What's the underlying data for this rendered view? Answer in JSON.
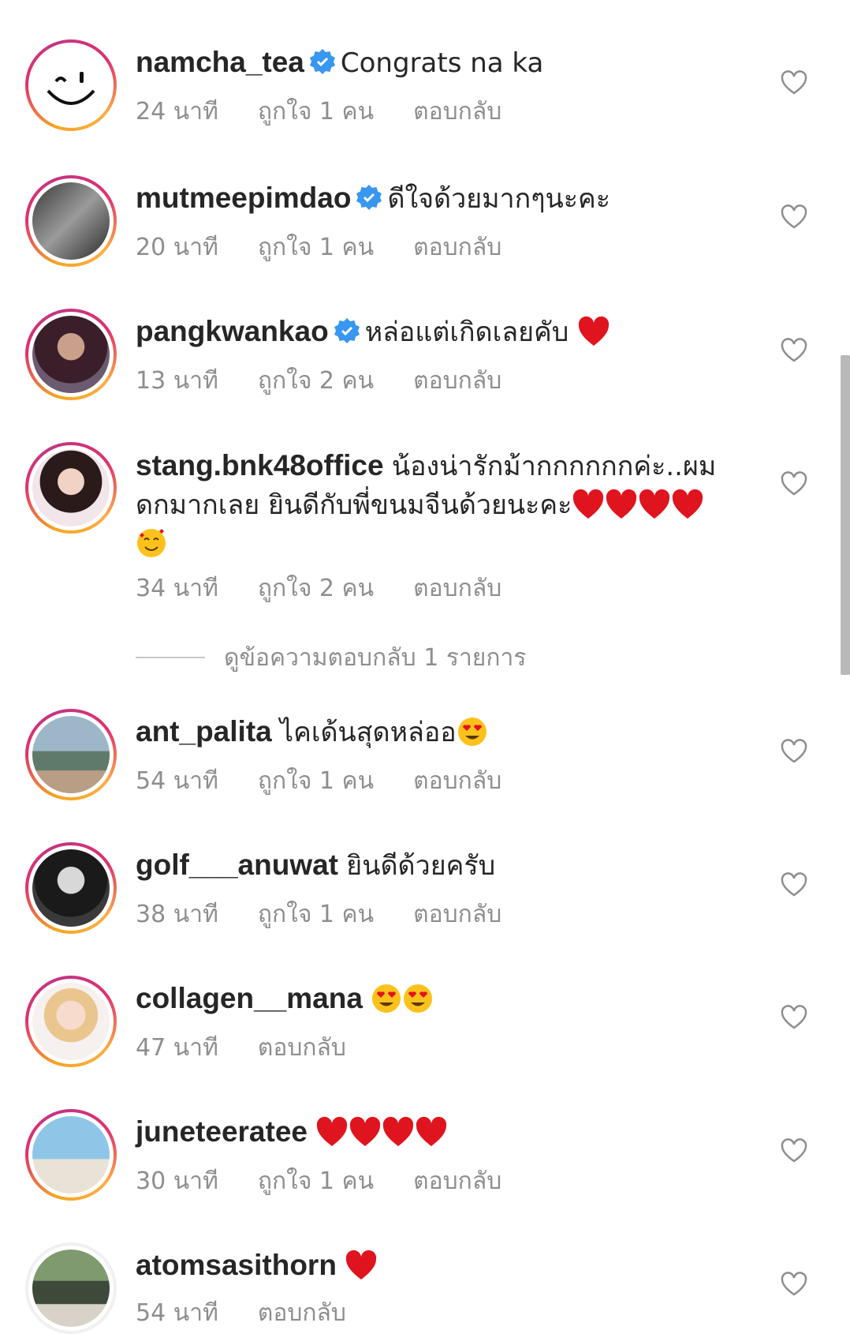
{
  "comments": [
    {
      "username": "namcha_tea",
      "verified": true,
      "text": "Congrats na ka",
      "emojis": [],
      "time": "24 นาที",
      "likes": "ถูกใจ 1 คน",
      "reply": "ตอบกลับ",
      "avatar_icon": "smiley-face-icon"
    },
    {
      "username": "mutmeepimdao",
      "verified": true,
      "text": "ดีใจด้วยมากๆนะคะ",
      "emojis": [],
      "time": "20 นาที",
      "likes": "ถูกใจ 1 คน",
      "reply": "ตอบกลับ",
      "avatar_icon": "profile-photo"
    },
    {
      "username": "pangkwankao",
      "verified": true,
      "text": "หล่อแต่เกิดเลยคับ",
      "emojis": [
        "red-heart"
      ],
      "time": "13 นาที",
      "likes": "ถูกใจ 2 คน",
      "reply": "ตอบกลับ",
      "avatar_icon": "profile-photo"
    },
    {
      "username": "stang.bnk48office",
      "verified": false,
      "text": "น้องน่ารักม้ากกกกกกค่ะ..ผมดกมากเลย ยินดีกับพี่ขนมจีนด้วยนะคะ",
      "emojis": [
        "red-heart",
        "red-heart",
        "red-heart",
        "red-heart",
        "smiling-face-with-hearts"
      ],
      "time": "34 นาที",
      "likes": "ถูกใจ 2 คน",
      "reply": "ตอบกลับ",
      "avatar_icon": "profile-photo"
    },
    {
      "username": "ant_palita",
      "verified": false,
      "text": "ไคเด้นสุดหล่ออ",
      "emojis": [
        "heart-eyes"
      ],
      "time": "54 นาที",
      "likes": "ถูกใจ 1 คน",
      "reply": "ตอบกลับ",
      "avatar_icon": "profile-photo"
    },
    {
      "username": "golf___anuwat",
      "verified": false,
      "text": "ยินดีด้วยครับ",
      "emojis": [],
      "time": "38 นาที",
      "likes": "ถูกใจ 1 คน",
      "reply": "ตอบกลับ",
      "avatar_icon": "profile-photo"
    },
    {
      "username": "collagen__mana",
      "verified": false,
      "text": "",
      "emojis": [
        "heart-eyes",
        "heart-eyes"
      ],
      "time": "47 นาที",
      "likes": "",
      "reply": "ตอบกลับ",
      "avatar_icon": "profile-photo"
    },
    {
      "username": "juneteeratee",
      "verified": false,
      "text": "",
      "emojis": [
        "red-heart",
        "red-heart",
        "red-heart",
        "red-heart"
      ],
      "time": "30 นาที",
      "likes": "ถูกใจ 1 คน",
      "reply": "ตอบกลับ",
      "avatar_icon": "profile-photo"
    },
    {
      "username": "atomsasithorn",
      "verified": false,
      "text": "",
      "emojis": [
        "red-heart"
      ],
      "time": "54 นาที",
      "likes": "",
      "reply": "ตอบกลับ",
      "avatar_icon": "profile-photo"
    }
  ],
  "view_replies": "ดูข้อความตอบกลับ 1 รายการ",
  "colors": {
    "verified": "#3897f0",
    "meta": "#8e8e8e",
    "heart": "#e0141e"
  }
}
